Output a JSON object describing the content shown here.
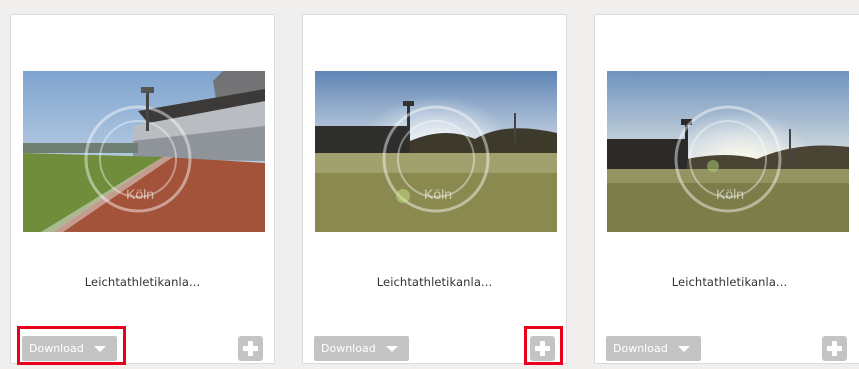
{
  "cards": [
    {
      "caption": "Leichtathletikanla...",
      "download_label": "Download",
      "image_alt": "stadium-with-red-track",
      "watermark_text": "Köln"
    },
    {
      "caption": "Leichtathletikanla...",
      "download_label": "Download",
      "image_alt": "frosty-grass-field-with-floodlights",
      "watermark_text": "Köln"
    },
    {
      "caption": "Leichtathletikanla...",
      "download_label": "Download",
      "image_alt": "sunlit-field-with-floodlight-tower",
      "watermark_text": "Köln"
    }
  ],
  "icons": {
    "add": "plus-icon",
    "dropdown": "caret-down-icon"
  },
  "colors": {
    "button_bg": "#c4c4c4",
    "highlight": "#e8001c",
    "page_bg": "#f0efed"
  }
}
